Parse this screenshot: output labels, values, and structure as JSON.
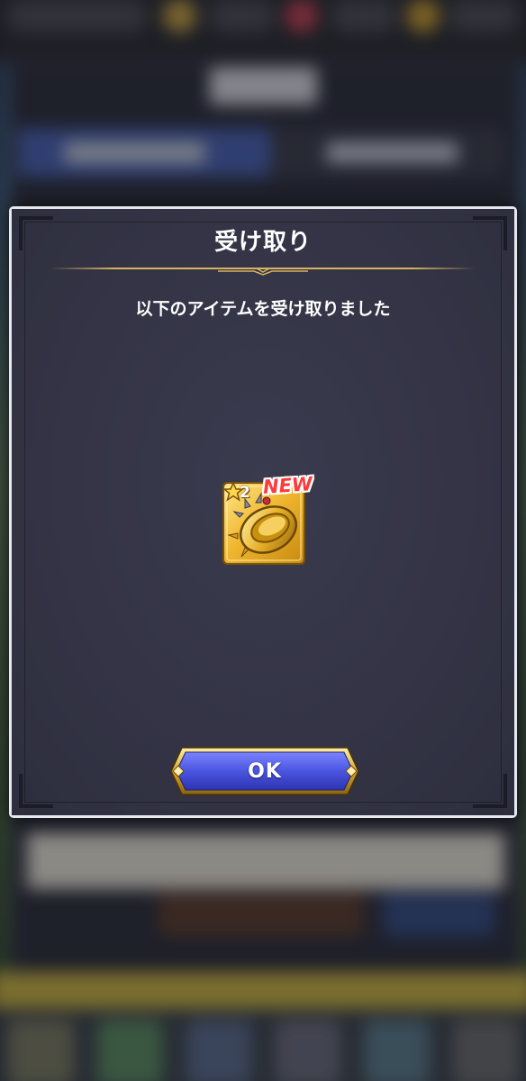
{
  "dialog": {
    "title": "受け取り",
    "message": "以下のアイテムを受け取りました",
    "ok_label": "OK"
  },
  "item": {
    "rarity": "2",
    "new_badge": "NEW",
    "icon": "golden-ring-icon"
  },
  "colors": {
    "dialog_bg": "#343446",
    "dialog_border": "#e7e7ee",
    "gold": "#d8b460",
    "button_blue": "#4a55e0",
    "new_red": "#ff3a3a"
  }
}
